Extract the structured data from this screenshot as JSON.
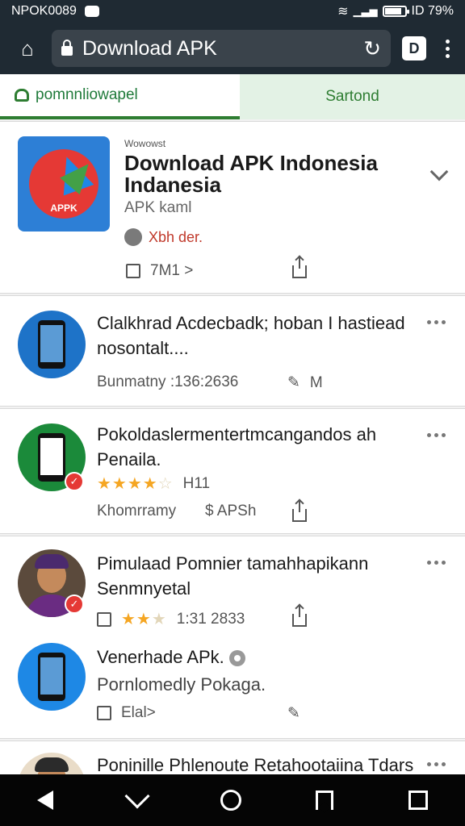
{
  "status": {
    "left_text": "NPOK0089",
    "battery_text": "ID 79%",
    "battery_level": 0.79
  },
  "toolbar": {
    "url": "Download APK",
    "home_icon": "home-icon",
    "reload_icon": "reload-icon",
    "tab_count": "D",
    "menu_icon": "more-vert-icon"
  },
  "tabs": [
    {
      "label": "pomnnliowapel",
      "active": true
    },
    {
      "label": "Sartond",
      "active": false
    }
  ],
  "featured": {
    "small_label": "Wowowst",
    "title": "Download APK Indonesia Indanesia",
    "icon_label": "APPK",
    "subtitle": "APK kaml",
    "developer": "Xbh der.",
    "action_label": "7M1 >"
  },
  "apps": [
    {
      "title": "Clalkhrad Acdecbadk; hoban I hastiead nosontalt....",
      "meta": "Bunmatny  :136:2636",
      "action": "M"
    },
    {
      "title": "Pokoldaslermentertmcangandos ah Penaila.",
      "rating": 4.5,
      "rating_text": "H11",
      "meta": "Khomrramy",
      "price": "$ APSh"
    },
    {
      "title": "Pimulaad Pomnier tamahhapikann Senmnyetal",
      "rating": 2.5,
      "rating_text": "1:31 2833"
    },
    {
      "title": "Venerhade APk.",
      "subtitle": "Pornlomedly Pokaga.",
      "action_label": "Elal>"
    },
    {
      "title": "Poninille Phlenoute Retahootaiina Tdars"
    }
  ]
}
